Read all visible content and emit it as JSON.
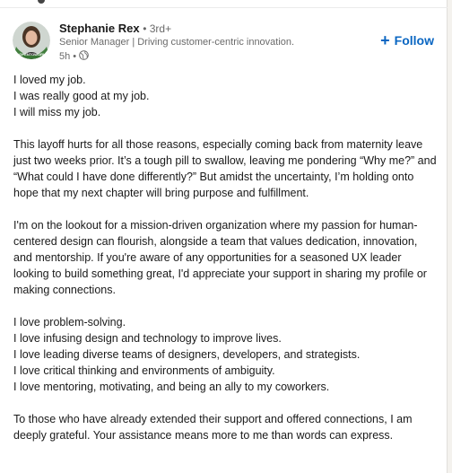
{
  "author": {
    "name": "Stephanie Rex",
    "degree": "• 3rd+",
    "headline": "Senior Manager | Driving customer-centric innovation.",
    "time": "5h •",
    "avatar_badge": "#OPENTOWORK",
    "avatar_badge_color": "#3a7a36"
  },
  "follow": {
    "label": "Follow",
    "color": "#0a66c2"
  },
  "post": {
    "p1": [
      "I loved my job.",
      "I was really good at my job.",
      "I will miss my job."
    ],
    "p2": "This layoff hurts for all those reasons, especially coming back from maternity leave just two weeks prior. It’s a tough pill to swallow, leaving me pondering “Why me?” and “What could I have done differently?” But amidst the uncertainty, I’m holding onto hope that my next chapter will bring purpose and fulfillment.",
    "p3": "I'm on the lookout for a mission-driven organization where my passion for human-centered design can flourish, alongside a team that values dedication, innovation, and mentorship. If you're aware of any opportunities for a seasoned UX leader looking to build something great, I'd appreciate your support in sharing my profile or making connections.",
    "p4": [
      "I love problem-solving.",
      "I love infusing design and technology to improve lives.",
      "I love leading diverse teams of designers, developers, and strategists.",
      "I love critical thinking and environments of ambiguity.",
      "I love mentoring, motivating, and being an ally to my coworkers."
    ],
    "p5": "To those who have already extended their support and offered connections, I am deeply grateful. Your assistance means more to me than words can express."
  }
}
